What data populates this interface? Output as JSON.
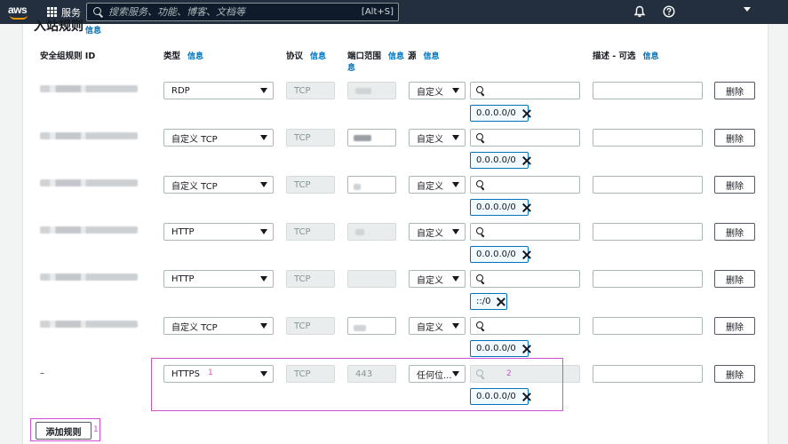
{
  "nav": {
    "logo": "aws",
    "services_label": "服务",
    "search_placeholder": "搜索服务、功能、博客、文档等",
    "search_shortcut": "[Alt+S]",
    "icons": [
      "grid-icon",
      "search-icon",
      "bell-icon",
      "help-icon",
      "caret-down-icon"
    ]
  },
  "section": {
    "title": "入站规则",
    "info": "信息"
  },
  "columns": {
    "rule_id": "安全组规则 ID",
    "type": "类型",
    "protocol": "协议",
    "port": "端口范围",
    "source": "源",
    "description": "描述 - 可选",
    "info": "信息",
    "info_wrap": "息"
  },
  "rules": [
    {
      "type": "RDP",
      "protocol": "TCP",
      "source": "自定义",
      "chips": [
        "0.0.0.0/0"
      ]
    },
    {
      "type": "自定义 TCP",
      "protocol": "TCP",
      "source": "自定义",
      "chips": [
        "0.0.0.0/0"
      ]
    },
    {
      "type": "自定义 TCP",
      "protocol": "TCP",
      "source": "自定义",
      "chips": [
        "0.0.0.0/0"
      ]
    },
    {
      "type": "HTTP",
      "protocol": "TCP",
      "source": "自定义",
      "chips": [
        "0.0.0.0/0"
      ]
    },
    {
      "type": "HTTP",
      "protocol": "TCP",
      "source": "自定义",
      "chips": [
        "::/0"
      ]
    },
    {
      "type": "自定义 TCP",
      "protocol": "TCP",
      "source": "自定义",
      "chips": [
        "0.0.0.0/0"
      ]
    }
  ],
  "new_rule": {
    "id": "–",
    "type": "HTTPS",
    "protocol": "TCP",
    "port": "443",
    "source": "任何位...",
    "chip": "0.0.0.0/0",
    "annotation_1": "1",
    "annotation_2": "2"
  },
  "delete_label": "删除",
  "add_rule": {
    "label": "添加规则",
    "annotation": "1"
  },
  "colors": {
    "nav_bg": "#232f3e",
    "accent": "#0073bb",
    "annotation": "#d14fd1",
    "orange": "#ff9900"
  }
}
